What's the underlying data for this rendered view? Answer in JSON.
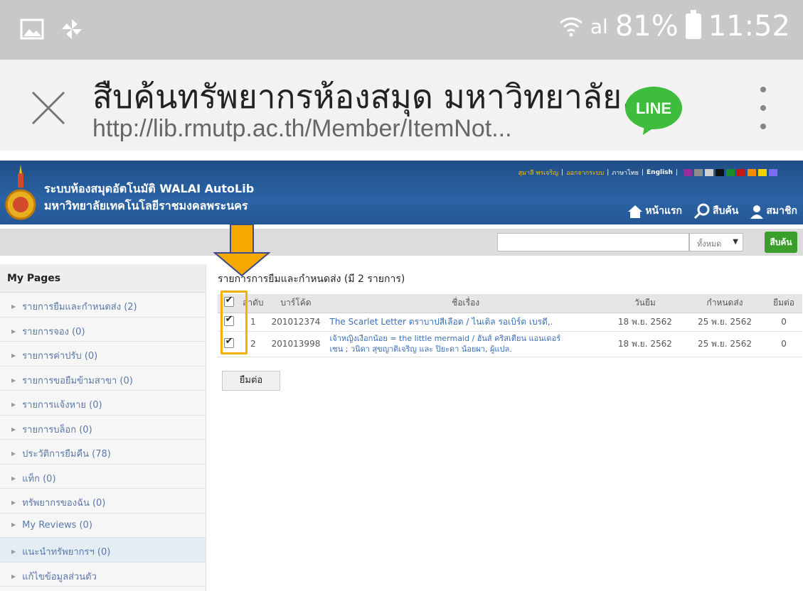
{
  "status_bar": {
    "signal": "al",
    "battery": "81%",
    "time": "11:52"
  },
  "browser": {
    "title": "สืบค้นทรัพยากรห้องสมุด มหาวิทยาลัย...",
    "url": "http://lib.rmutp.ac.th/Member/ItemNot...",
    "line_label": "LINE"
  },
  "site": {
    "name_line1": "ระบบห้องสมุดอัตโนมัติ WALAI AutoLib",
    "name_line2": "มหาวิทยาลัยเทคโนโลยีราชมงคลพระนคร",
    "user_name": "สุมาลี พรเจริญ",
    "logout": "ออกจากระบบ",
    "lang_th": "ภาษาไทย",
    "lang_en": "English",
    "sep": "|",
    "swatch_colors": [
      "#9b2d9b",
      "#8c8c8c",
      "#d0d0d0",
      "#111111",
      "#1a8c2a",
      "#c41818",
      "#f28c00",
      "#f2d300",
      "#7c6cf0"
    ],
    "nav": [
      {
        "label": "หน้าแรก",
        "icon": "home-icon"
      },
      {
        "label": "สืบค้น",
        "icon": "search-icon"
      },
      {
        "label": "สมาชิก",
        "icon": "user-icon"
      }
    ]
  },
  "search": {
    "scope": "ทั้งหมด",
    "button": "สืบค้น"
  },
  "sidebar": {
    "title": "My Pages",
    "items": [
      {
        "label": "รายการยืมและกำหนดส่ง (2)"
      },
      {
        "label": "รายการจอง (0)"
      },
      {
        "label": "รายการค่าปรับ (0)"
      },
      {
        "label": "รายการขอยืมข้ามสาขา (0)"
      },
      {
        "label": "รายการแจ้งหาย (0)"
      },
      {
        "label": "รายการบล็อก (0)"
      },
      {
        "label": "ประวัติการยืมคืน (78)"
      },
      {
        "label": "แท็ก (0)"
      },
      {
        "label": "ทรัพยากรของฉัน (0)"
      },
      {
        "label": "My Reviews (0)"
      },
      {
        "label": "แนะนำทรัพยากรฯ (0)"
      },
      {
        "label": "แก้ไขข้อมูลส่วนตัว"
      }
    ]
  },
  "content": {
    "title": "รายการการยืมและกำหนดส่ง (มี 2 รายการ)",
    "columns": [
      "ลำดับ",
      "บาร์โค้ด",
      "ชื่อเรื่อง",
      "วันยืม",
      "กำหนดส่ง",
      "ยืมต่อ"
    ],
    "rows": [
      {
        "no": "1",
        "barcode": "201012374",
        "title_line1": "The Scarlet Letter ตราบาปสีเลือด / ไนเติล รอเบิร์ต เบรดี,.",
        "title_line2": "",
        "borrow_date": "18 พ.ย. 2562",
        "due_date": "25 พ.ย. 2562",
        "renew_count": "0"
      },
      {
        "no": "2",
        "barcode": "201013998",
        "title_line1": "เจ้าหญิงเงือกน้อย = the little mermaid / ฮันส์ คริสเตียน แอนเดอร์",
        "title_line2": "เซน ; วนิดา สุขญาติเจริญ และ ปิยะดา น้อยผา, ผู้แปล.",
        "borrow_date": "18 พ.ย. 2562",
        "due_date": "25 พ.ย. 2562",
        "renew_count": "0"
      }
    ],
    "renew_button": "ยืมต่อ"
  },
  "annotation": {
    "highlight_color": "#f5b000",
    "arrow_color": "#f5a800"
  }
}
